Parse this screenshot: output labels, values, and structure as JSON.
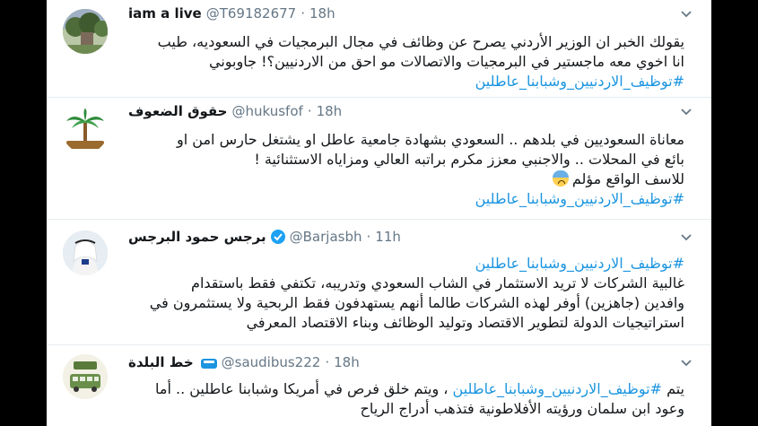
{
  "tweets": [
    {
      "name": "iam a live",
      "handle": "@T69182677",
      "dot": "·",
      "time": "18h",
      "lines": [
        "يقولك الخبر ان الوزير الأردني يصرح عن وظائف في مجال البرمجيات في السعوديه، طيب",
        "انا اخوي معه ماجستير في البرمجيات  والاتصالات مو احق من الاردنيين؟! جاوبوني"
      ],
      "hashtag": "#توظيف_الاردنيين_وشبابنا_عاطلين"
    },
    {
      "name": "حقوق الضعوف",
      "handle": "@hukusfof",
      "dot": "·",
      "time": "18h",
      "avatar_text": "حقوق الضعوف",
      "lines": [
        "معاناة السعوديين في بلدهم .. السعودي بشهادة جامعية عاطل او يشتغل حارس امن او",
        "بائع في المحلات .. والاجنبي معزز مكرم براتبه العالي ومزاياه الاستثنائية !",
        "للاسف الواقع مؤلم"
      ],
      "hashtag": "#توظيف_الاردنيين_وشبابنا_عاطلين"
    },
    {
      "name": "برجس حمود البرجس",
      "handle": "@Barjasbh",
      "dot": "·",
      "time": "11h",
      "hashtag": "#توظيف_الاردنيين_وشبابنا_عاطلين",
      "lines": [
        "غالبية الشركات لا تريد الاستثمار في الشاب السعودي وتدريبه، تكتفي فقط باستقدام",
        "وافدين (جاهزين) أوفر لهذه الشركات طالما أنهم يستهدفون فقط الربحية ولا يستثمرون في",
        "استراتيجيات الدولة لتطوير الاقتصاد وتوليد الوظائف وبناء الاقتصاد المعرفي"
      ]
    },
    {
      "name": "خط البلدة",
      "handle": "@saudibus222",
      "dot": "·",
      "time": "18h",
      "avatar_text": "خط البلدة",
      "line1_prefix": "يتم",
      "line1_tag": "#توظيف_الاردنيين_وشبابنا_عاطلين",
      "line1_suffix": "، ويتم خلق فرص في أمريكا وشبابنا عاطلين .. أما",
      "line2": "وعود ابن سلمان ورؤيته الأفلاطونية فتذهب أدراج الرياح"
    }
  ],
  "colors": {
    "link": "#1b95e0",
    "meta": "#657786",
    "text": "#14171a",
    "divider": "#e6ecf0"
  }
}
